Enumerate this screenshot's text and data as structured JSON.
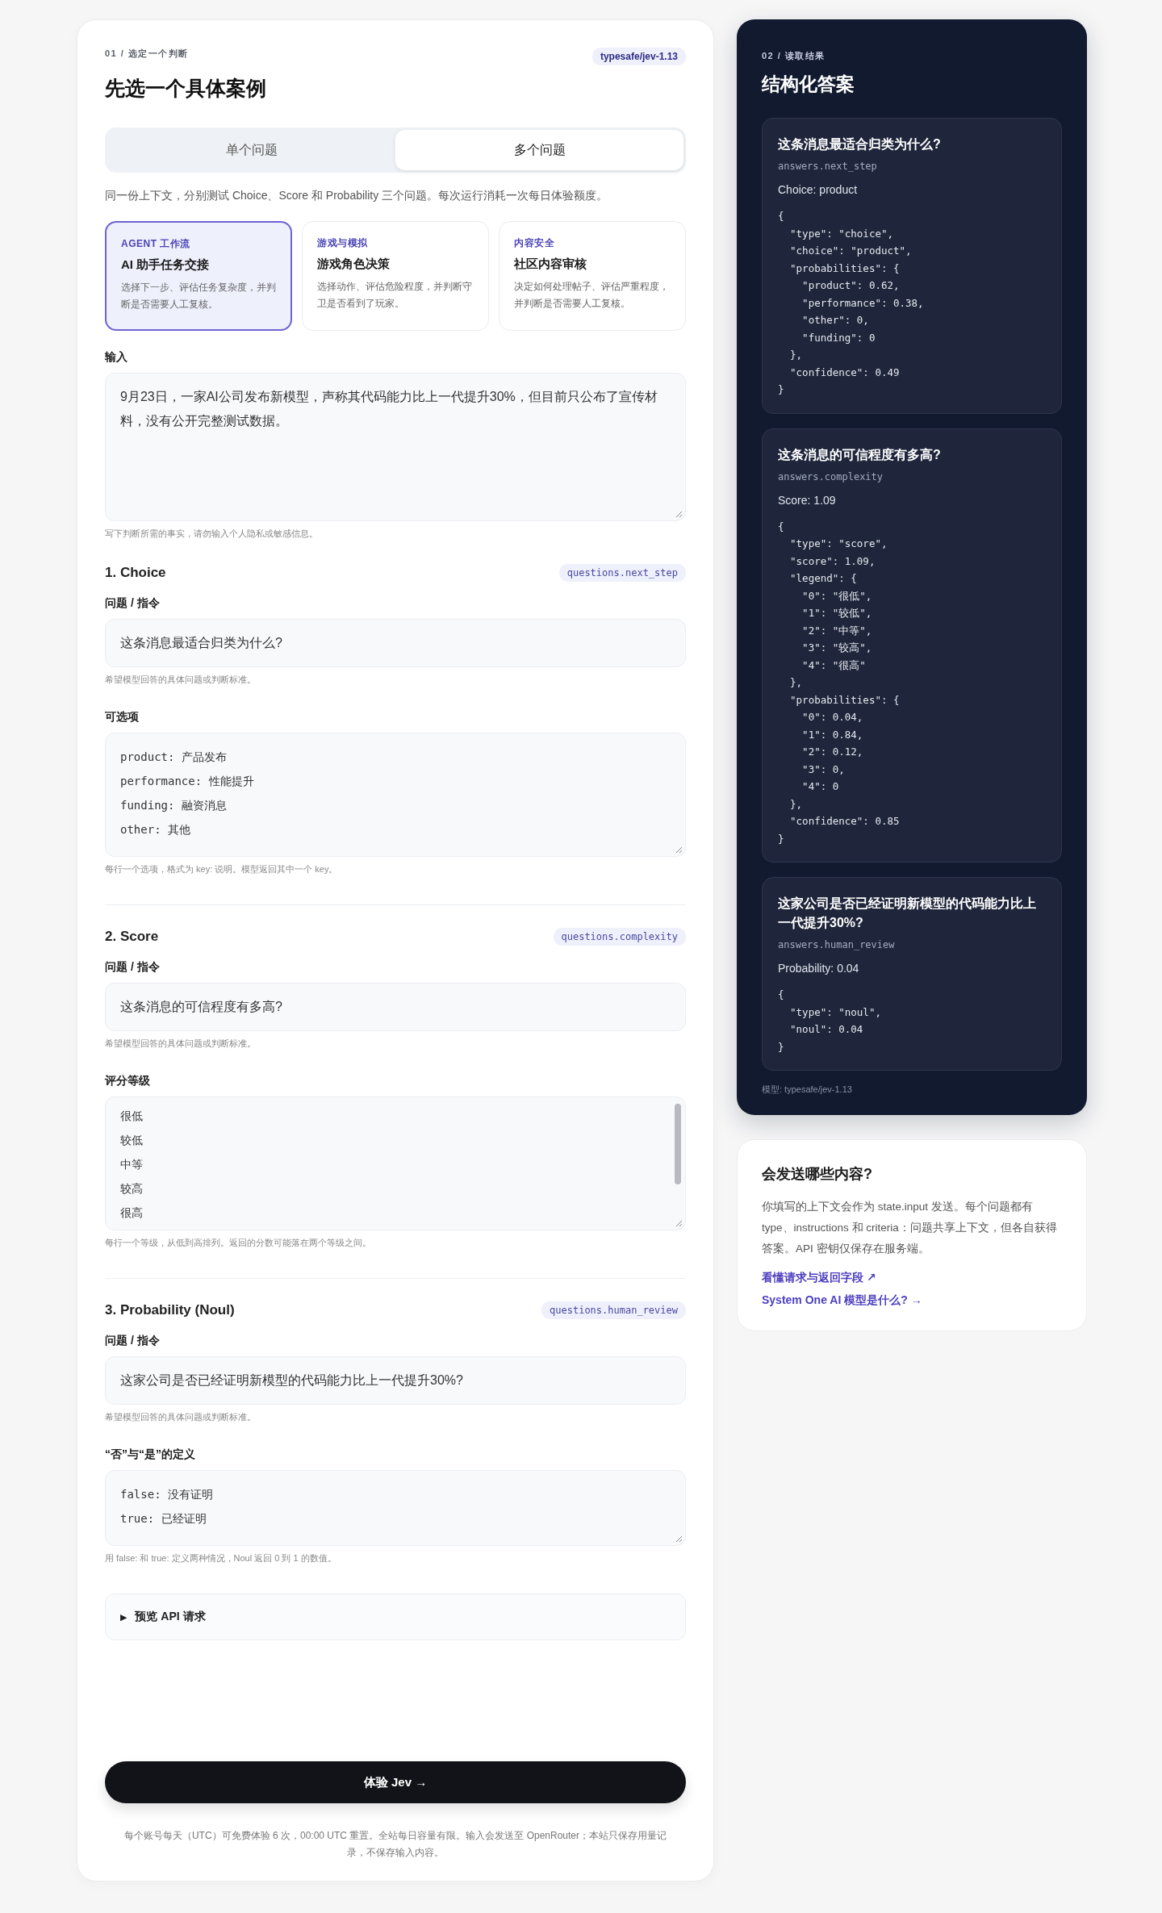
{
  "form": {
    "step": "01 / 选定一个判断",
    "title": "先选一个具体案例",
    "model_badge": "typesafe/jev-1.13",
    "tabs": [
      {
        "label": "单个问题",
        "selected": false
      },
      {
        "label": "多个问题",
        "selected": true
      }
    ],
    "description": "同一份上下文，分别测试 Choice、Score 和 Probability 三个问题。每次运行消耗一次每日体验额度。",
    "examples": [
      {
        "category": "AGENT 工作流",
        "title": "AI 助手任务交接",
        "description": "选择下一步、评估任务复杂度，并判断是否需要人工复核。",
        "selected": true
      },
      {
        "category": "游戏与模拟",
        "title": "游戏角色决策",
        "description": "选择动作、评估危险程度，并判断守卫是否看到了玩家。",
        "selected": false
      },
      {
        "category": "内容安全",
        "title": "社区内容审核",
        "description": "决定如何处理帖子、评估严重程度，并判断是否需要人工复核。",
        "selected": false
      }
    ],
    "input": {
      "label": "输入",
      "value": "9月23日，一家AI公司发布新模型，声称其代码能力比上一代提升30%，但目前只公布了宣传材料，没有公开完整测试数据。",
      "hint": "写下判断所需的事实，请勿输入个人隐私或敏感信息。"
    },
    "questions": [
      {
        "heading": "1. Choice",
        "path": "questions.next_step",
        "fields": [
          {
            "kind": "line",
            "label": "问题 / 指令",
            "value": "这条消息最适合归类为什么?",
            "hint": "希望模型回答的具体问题或判断标准。"
          },
          {
            "kind": "lines",
            "label": "可选项",
            "lines": [
              "product: 产品发布",
              "performance: 性能提升",
              "funding: 融资消息",
              "other: 其他"
            ],
            "scrollable": false,
            "hint": "每行一个选项，格式为 key: 说明。模型返回其中一个 key。"
          }
        ]
      },
      {
        "heading": "2. Score",
        "path": "questions.complexity",
        "fields": [
          {
            "kind": "line",
            "label": "问题 / 指令",
            "value": "这条消息的可信程度有多高?",
            "hint": "希望模型回答的具体问题或判断标准。"
          },
          {
            "kind": "lines",
            "label": "评分等级",
            "lines": [
              "很低",
              "较低",
              "中等",
              "较高",
              "很高"
            ],
            "scrollable": true,
            "hint": "每行一个等级，从低到高排列。返回的分数可能落在两个等级之间。"
          }
        ]
      },
      {
        "heading": "3. Probability (Noul)",
        "path": "questions.human_review",
        "fields": [
          {
            "kind": "line",
            "label": "问题 / 指令",
            "value": "这家公司是否已经证明新模型的代码能力比上一代提升30%?",
            "hint": "希望模型回答的具体问题或判断标准。"
          },
          {
            "kind": "lines",
            "label": "“否”与“是”的定义",
            "lines": [
              "false: 没有证明",
              "true: 已经证明"
            ],
            "scrollable": false,
            "hint": "用 false: 和 true: 定义两种情况，Noul 返回 0 到 1 的数值。"
          }
        ]
      }
    ],
    "preview": {
      "icon": "▶",
      "label": "预览 API 请求",
      "expanded": false
    },
    "submit_button": "体验 Jev →",
    "footnote": "每个账号每天（UTC）可免费体验 6 次，00:00 UTC 重置。全站每日容量有限。输入会发送至 OpenRouter；本站只保存用量记录，不保存输入内容。"
  },
  "results": {
    "step": "02 / 读取结果",
    "title": "结构化答案",
    "answers": [
      {
        "question": "这条消息最适合归类为什么?",
        "path": "answers.next_step",
        "summary": "Choice: product",
        "json_lines": [
          "{",
          "  \"type\": \"choice\",",
          "  \"choice\": \"product\",",
          "  \"probabilities\": {",
          "    \"product\": 0.62,",
          "    \"performance\": 0.38,",
          "    \"other\": 0,",
          "    \"funding\": 0",
          "  },",
          "  \"confidence\": 0.49",
          "}"
        ]
      },
      {
        "question": "这条消息的可信程度有多高?",
        "path": "answers.complexity",
        "summary": "Score: 1.09",
        "json_lines": [
          "{",
          "  \"type\": \"score\",",
          "  \"score\": 1.09,",
          "  \"legend\": {",
          "    \"0\": \"很低\",",
          "    \"1\": \"较低\",",
          "    \"2\": \"中等\",",
          "    \"3\": \"较高\",",
          "    \"4\": \"很高\"",
          "  },",
          "  \"probabilities\": {",
          "    \"0\": 0.04,",
          "    \"1\": 0.84,",
          "    \"2\": 0.12,",
          "    \"3\": 0,",
          "    \"4\": 0",
          "  },",
          "  \"confidence\": 0.85",
          "}"
        ]
      },
      {
        "question": "这家公司是否已经证明新模型的代码能力比上一代提升30%?",
        "path": "answers.human_review",
        "summary": "Probability: 0.04",
        "json_lines": [
          "{",
          "  \"type\": \"noul\",",
          "  \"noul\": 0.04",
          "}"
        ]
      }
    ],
    "model_note": "模型: typesafe/jev-1.13"
  },
  "info": {
    "title": "会发送哪些内容?",
    "body": "你填写的上下文会作为 state.input 发送。每个问题都有 type、instructions 和 criteria：问题共享上下文，但各自获得答案。API 密钥仅保存在服务端。",
    "links": [
      "看懂请求与返回字段 ↗",
      "System One AI 模型是什么? →"
    ]
  }
}
